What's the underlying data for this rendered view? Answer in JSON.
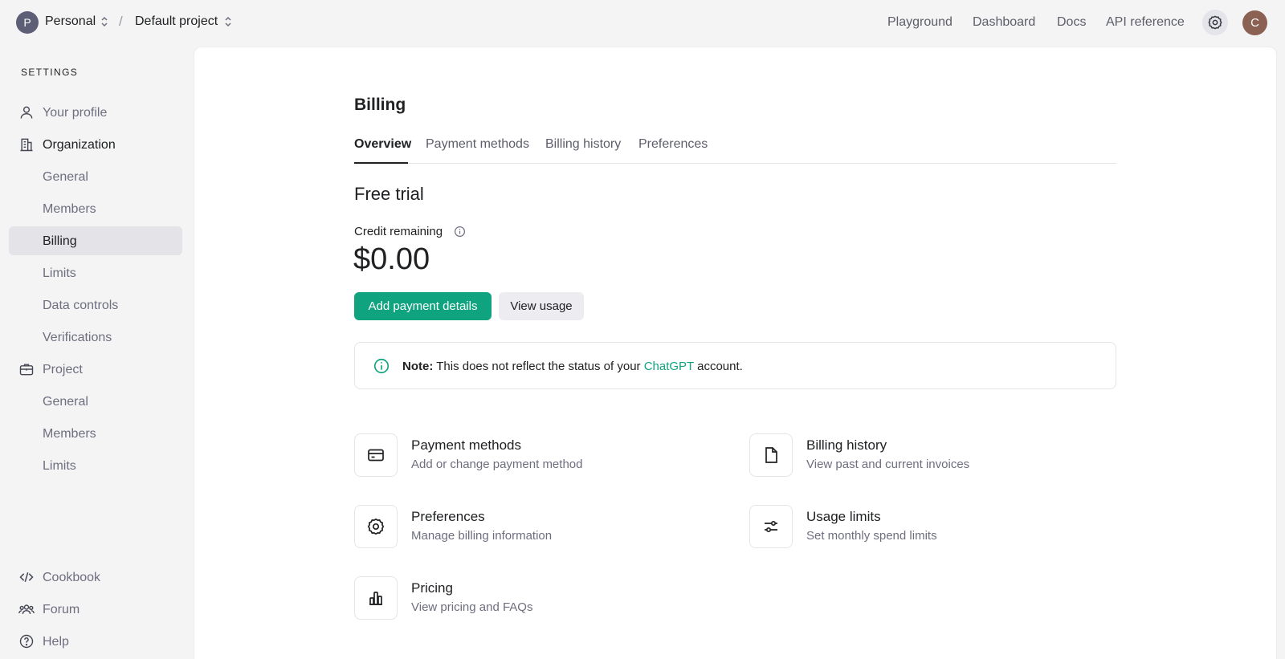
{
  "topbar": {
    "org_initial": "P",
    "org_name": "Personal",
    "separator": "/",
    "project_name": "Default project",
    "nav": [
      "Playground",
      "Dashboard",
      "Docs",
      "API reference"
    ],
    "user_initial": "C"
  },
  "sidebar": {
    "heading": "SETTINGS",
    "items": [
      {
        "label": "Your profile",
        "icon": "user-icon"
      },
      {
        "label": "Organization",
        "icon": "building-icon"
      },
      {
        "label": "General"
      },
      {
        "label": "Members"
      },
      {
        "label": "Billing",
        "active": true
      },
      {
        "label": "Limits"
      },
      {
        "label": "Data controls"
      },
      {
        "label": "Verifications"
      },
      {
        "label": "Project",
        "icon": "briefcase-icon"
      },
      {
        "label": "General"
      },
      {
        "label": "Members"
      },
      {
        "label": "Limits"
      }
    ],
    "footer": [
      {
        "label": "Cookbook",
        "icon": "code-icon"
      },
      {
        "label": "Forum",
        "icon": "people-icon"
      },
      {
        "label": "Help",
        "icon": "help-icon"
      }
    ]
  },
  "billing": {
    "title": "Billing",
    "tabs": [
      "Overview",
      "Payment methods",
      "Billing history",
      "Preferences"
    ],
    "active_tab": "Overview",
    "plan": "Free trial",
    "credit_label": "Credit remaining",
    "credit_value": "$0.00",
    "add_payment_label": "Add payment details",
    "view_usage_label": "View usage",
    "note": {
      "bold": "Note:",
      "text_before": "This does not reflect the status of your",
      "link": "ChatGPT",
      "text_after": "account."
    },
    "cards": [
      {
        "title": "Payment methods",
        "desc": "Add or change payment method",
        "icon": "credit-card-icon"
      },
      {
        "title": "Billing history",
        "desc": "View past and current invoices",
        "icon": "document-icon"
      },
      {
        "title": "Preferences",
        "desc": "Manage billing information",
        "icon": "gear-icon"
      },
      {
        "title": "Usage limits",
        "desc": "Set monthly spend limits",
        "icon": "sliders-icon"
      },
      {
        "title": "Pricing",
        "desc": "View pricing and FAQs",
        "icon": "bar-chart-icon"
      }
    ]
  },
  "colors": {
    "accent": "#10a37f",
    "sidebar_active": "#e3e3e8",
    "background": "#f4f4f4"
  }
}
